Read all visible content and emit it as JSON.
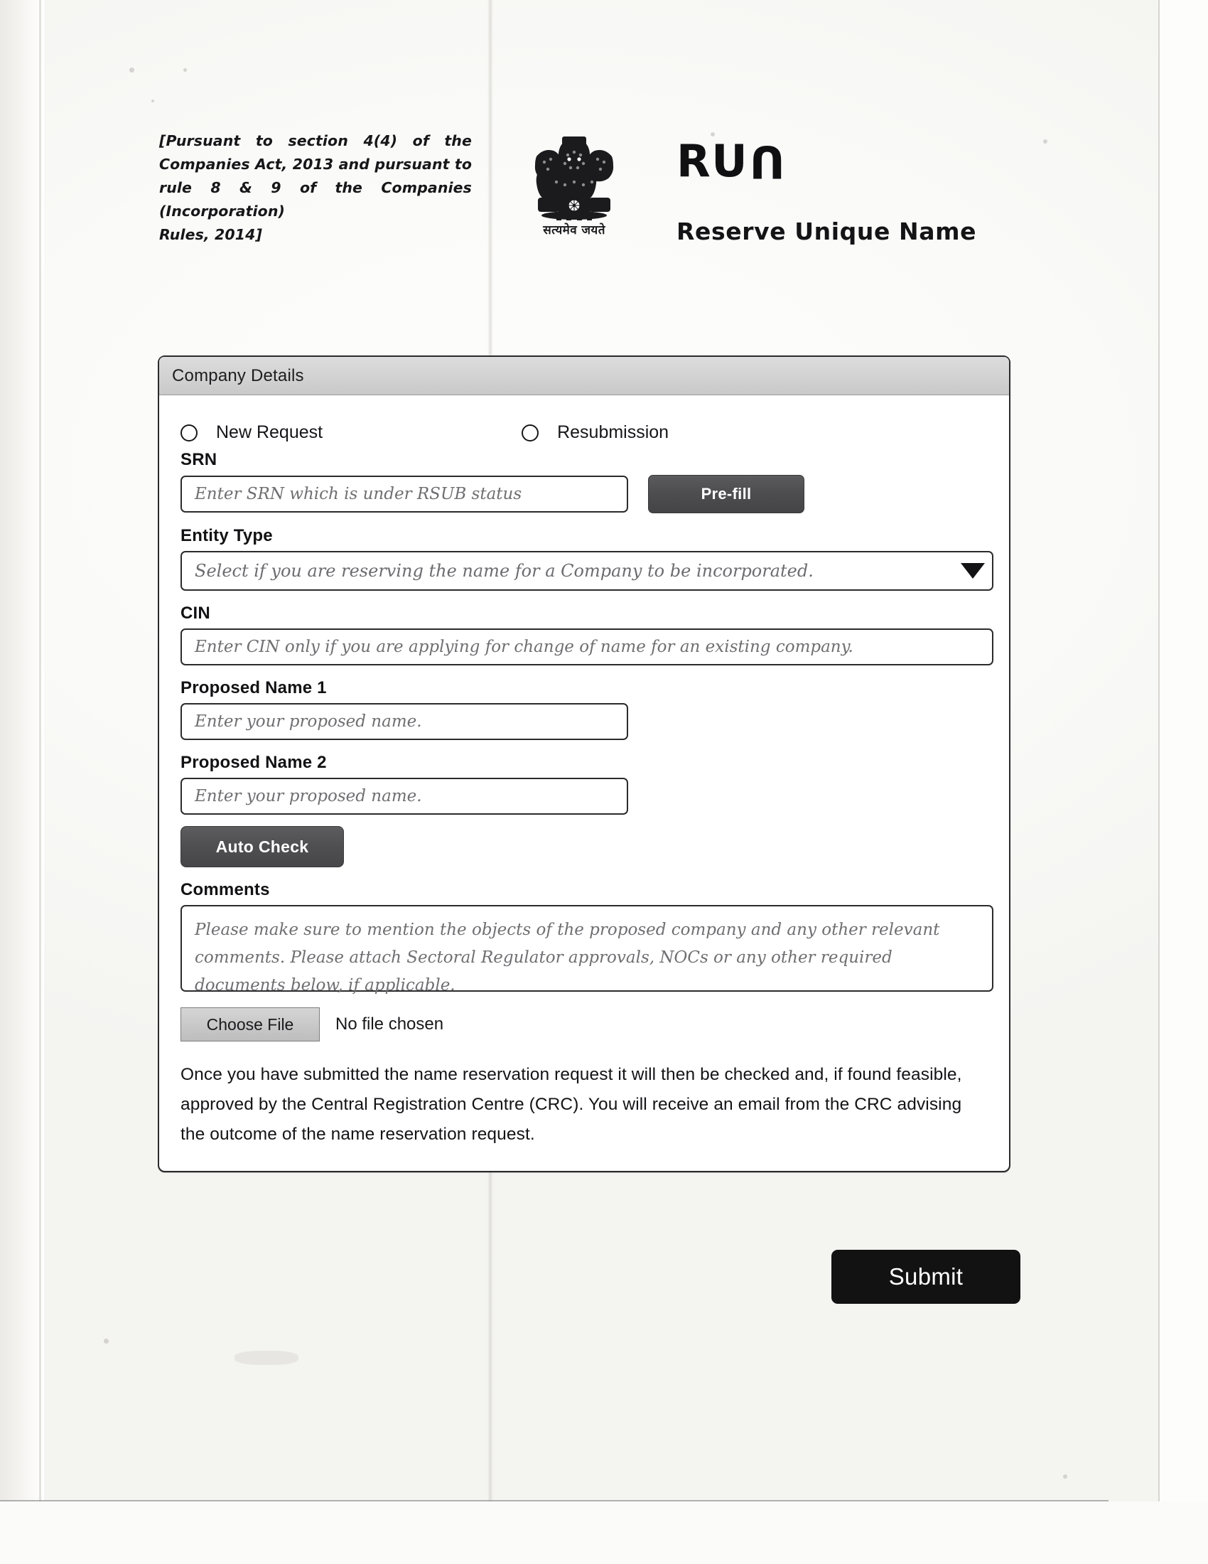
{
  "header": {
    "pursuant_note_lines": [
      "[Pursuant to section 4(4) of the",
      "Companies Act, 2013 and pursuant to rule",
      "8 & 9 of the Companies (Incorporation)",
      "Rules, 2014]"
    ],
    "emblem_motto": "सत्यमेव जयते",
    "emblem_name": "state-emblem-of-india",
    "logo_text": "RUN",
    "logo_letters": {
      "first": "R",
      "second": "U",
      "third": "N"
    },
    "subtitle": "Reserve Unique Name"
  },
  "form": {
    "card_title": "Company Details",
    "request_type": {
      "options": [
        {
          "label": "New Request",
          "selected": false
        },
        {
          "label": "Resubmission",
          "selected": false
        }
      ]
    },
    "srn": {
      "label": "SRN",
      "value": "",
      "placeholder": "Enter SRN which is under RSUB status",
      "prefill_button": "Pre-fill"
    },
    "entity_type": {
      "label": "Entity Type",
      "value": "",
      "placeholder": "Select if you are reserving the name for a Company to be incorporated."
    },
    "cin": {
      "label": "CIN",
      "value": "",
      "placeholder": "Enter CIN only if you are applying for change of name for an existing company."
    },
    "proposed_name_1": {
      "label": "Proposed Name 1",
      "value": "",
      "placeholder": "Enter your proposed name."
    },
    "proposed_name_2": {
      "label": "Proposed Name 2",
      "value": "",
      "placeholder": "Enter your proposed name."
    },
    "auto_check_button": "Auto Check",
    "comments": {
      "label": "Comments",
      "value": "",
      "placeholder": "Please make sure to mention the objects of the proposed company and any other relevant comments. Please attach Sectoral Regulator approvals, NOCs or any other required documents below, if applicable."
    },
    "file_upload": {
      "button_label": "Choose File",
      "status": "No file chosen"
    },
    "info_paragraph": "Once you have submitted the name reservation request it will then be checked and, if found feasible, approved by the Central Registration Centre (CRC). You will receive an email from the CRC advising the outcome of the name reservation request.",
    "submit_button": "Submit"
  },
  "colors": {
    "page_background": "#faf9f7",
    "card_border": "#2a2a2c",
    "card_header": "#d2d2d2",
    "dark_button": "#4e4e50",
    "submit_button": "#121213",
    "placeholder_text": "#6f6f72",
    "body_text": "#141417"
  }
}
